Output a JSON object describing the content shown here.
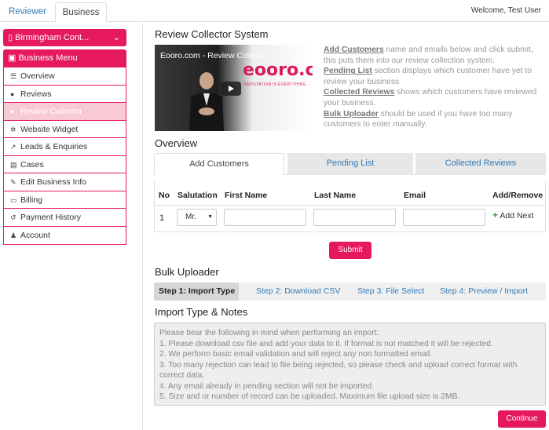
{
  "topbar": {
    "tabs": [
      "Reviewer",
      "Business"
    ],
    "welcome": "Welcome, Test User"
  },
  "sidebar": {
    "business_select": "Birmingham Cont...",
    "menu_title": "Business Menu",
    "items": [
      {
        "label": "Overview",
        "icon": "list-icon"
      },
      {
        "label": "Reviews",
        "icon": "comments-icon"
      },
      {
        "label": "Review Collector",
        "icon": "users-icon",
        "active": true
      },
      {
        "label": "Website Widget",
        "icon": "gear-icon"
      },
      {
        "label": "Leads & Enquiries",
        "icon": "line-chart-icon"
      },
      {
        "label": "Cases",
        "icon": "file-icon"
      },
      {
        "label": "Edit Business Info",
        "icon": "edit-icon"
      },
      {
        "label": "Billing",
        "icon": "credit-card-icon"
      },
      {
        "label": "Payment History",
        "icon": "history-icon"
      },
      {
        "label": "Account",
        "icon": "user-icon"
      }
    ],
    "accent_color": "#e5195b"
  },
  "main": {
    "title": "Review Collector System",
    "video": {
      "title": "Eooro.com - Review Collect...",
      "logo_text": "eooro.com",
      "tagline": "REPUTATION IS EVERYTHING"
    },
    "description": [
      {
        "link": "Add Customers",
        "text": " name and emails below and click submit, this puts them into our review collection system."
      },
      {
        "link": "Pending List",
        "text": " section displays which customer have yet to review your business"
      },
      {
        "link": "Collected Reviews",
        "text": " shows which customers have reviewed your business."
      },
      {
        "link": "Bulk Uploader",
        "text": " should be used if you have too many customers to enter manually."
      }
    ],
    "overview": {
      "heading": "Overview",
      "tabs": [
        "Add Customers",
        "Pending List",
        "Collected Reviews"
      ],
      "columns": [
        "No",
        "Salutation",
        "First Name",
        "Last Name",
        "Email",
        "Add/Remove"
      ],
      "row": {
        "no": "1",
        "salutation": "Mr.",
        "first_name": "",
        "last_name": "",
        "email": ""
      },
      "add_next_label": "Add Next",
      "submit_label": "Submit"
    },
    "bulk": {
      "heading": "Bulk Uploader",
      "steps": [
        "Step 1: Import Type",
        "Step 2: Download CSV",
        "Step 3: File Select",
        "Step 4: Preview / Import"
      ],
      "notes_heading": "Import Type & Notes",
      "notes": [
        "Please bear the following in mind when performing an import:",
        "1. Please download csv file and add your data to it. If format is not matched it will be rejected.",
        "2. We perform basic email validation and will reject any non formatted email.",
        "3. Too many rejection can lead to file being rejected, so please check and upload correct format with correct data.",
        "4. Any email already in pending section will not be imported.",
        "5. Size and or number of record can be uploaded. Maximum file upload size is 2MB."
      ],
      "continue_label": "Continue"
    }
  }
}
